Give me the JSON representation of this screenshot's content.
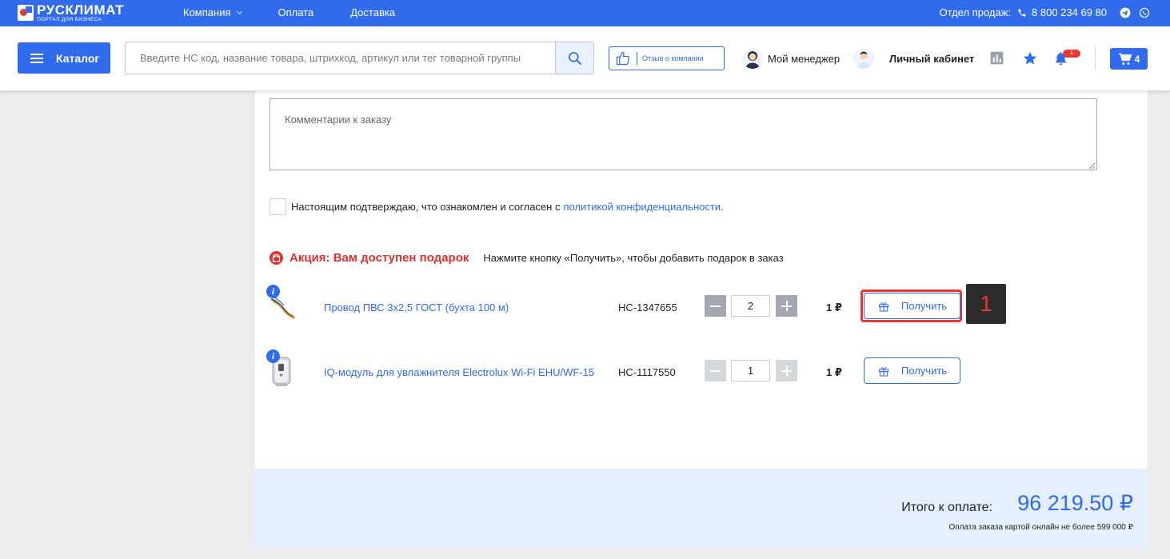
{
  "topbar": {
    "logo_name": "РУСКЛИМАТ",
    "logo_sub": "ПОРТАЛ ДЛЯ БИЗНЕСА",
    "nav": [
      "Компания",
      "Оплата",
      "Доставка"
    ],
    "sales_label": "Отдел продаж:",
    "phone": "8 800 234 69 80"
  },
  "header": {
    "catalog_label": "Каталог",
    "search_placeholder": "Введите НС код, название товара, штрихкод, артикул или тег товарной группы",
    "review_label": "Отзыв о компании",
    "manager_label": "Мой менеджер",
    "cabinet_label": "Личный кабинет",
    "notification_count": "1",
    "cart_count": "4"
  },
  "order": {
    "comment_placeholder": "Комментарии к заказу",
    "agree_text": "Настоящим подтверждаю, что ознакомлен и согласен с",
    "agree_link": "политикой конфиденциальности",
    "agree_end": ".",
    "promo_title": "Акция: Вам доступен подарок",
    "promo_sub": "Нажмите кнопку «Получить», чтобы добавить подарок в заказ",
    "gifts": [
      {
        "name": "Провод ПВС 3х2,5 ГОСТ (бухта 100 м)",
        "code": "НС-1347655",
        "qty": "2",
        "price": "1 ₽",
        "button": "Получить",
        "marker": "1"
      },
      {
        "name": "IQ-модуль для увлажнителя Electrolux Wi-Fi EHU/WF-15",
        "code": "НС-1117550",
        "qty": "1",
        "price": "1 ₽",
        "button": "Получить"
      }
    ]
  },
  "total": {
    "label": "Итого к оплате:",
    "value": "96 219.50 ₽",
    "note": "Оплата заказа картой онлайн не более 599 000 ₽"
  },
  "colors": {
    "brand": "#2f6bea",
    "accent_red": "#d9332b",
    "total_bg": "#e5efff"
  }
}
